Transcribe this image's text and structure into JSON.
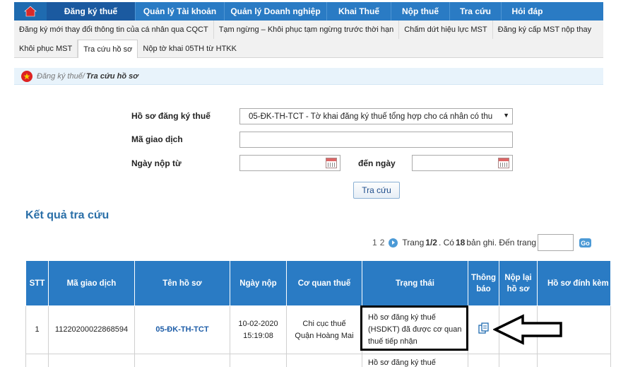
{
  "topnav": {
    "tabs": [
      {
        "label": "Đăng ký thuế",
        "active": true
      },
      {
        "label": "Quản lý Tài khoản"
      },
      {
        "label": "Quản lý Doanh nghiệp"
      },
      {
        "label": "Khai Thuế"
      },
      {
        "label": "Nộp thuế"
      },
      {
        "label": "Tra cứu"
      },
      {
        "label": "Hỏi đáp"
      }
    ]
  },
  "subnav": {
    "row1": [
      "Đăng ký mới thay đổi thông tin của cá nhân qua CQCT",
      "Tạm ngừng – Khôi phục tạm ngừng trước thời hạn",
      "Chấm dứt hiệu lực MST",
      "Đăng ký cấp MST nộp thay"
    ],
    "row2": [
      "Khôi phục MST",
      "Tra cứu hồ sơ",
      "Nộp tờ khai 05TH từ HTKK"
    ],
    "active": "Tra cứu hồ sơ"
  },
  "breadcrumb": {
    "parent": "Đăng ký thuế/",
    "current": "Tra cứu hồ sơ"
  },
  "form": {
    "ho_so_label": "Hồ sơ đăng ký thuế",
    "ho_so_value": "05-ĐK-TH-TCT - Tờ khai đăng ký thuế tổng hợp cho cá nhân có thu",
    "ma_gd_label": "Mã giao dịch",
    "ma_gd_value": "",
    "ngay_tu_label": "Ngày nộp từ",
    "ngay_tu_value": "",
    "den_ngay_label": "đến ngày",
    "den_ngay_value": "",
    "search_button": "Tra cứu"
  },
  "results": {
    "title": "Kết quả tra cứu",
    "pages": [
      "1",
      "2"
    ],
    "page_text_1": "Trang",
    "page_current": "1/2",
    "page_text_2": ". Có",
    "record_count": "18",
    "page_text_3": "bản ghi. Đến trang",
    "page_input": "",
    "go_label": "Go",
    "columns": [
      "STT",
      "Mã giao dịch",
      "Tên hồ sơ",
      "Ngày nộp",
      "Cơ quan thuế",
      "Trạng thái",
      "Thông báo",
      "Nộp lại hồ sơ",
      "Hồ sơ đính kèm"
    ],
    "rows": [
      {
        "stt": "1",
        "ma_gd": "11220200022868594",
        "ten_ho_so": "05-ĐK-TH-TCT",
        "ngay_nop_date": "10-02-2020",
        "ngay_nop_time": "15:19:08",
        "co_quan_1": "Chi cục thuế",
        "co_quan_2": "Quận Hoàng Mai",
        "trang_thai": "Hồ sơ đăng ký thuế (HSDKT) đã được cơ quan thuế tiếp nhận"
      },
      {
        "trang_thai": "Hồ sơ đăng ký thuế"
      }
    ]
  },
  "colors": {
    "nav_blue": "#2a7bc4",
    "title_blue": "#2a6fa8"
  }
}
